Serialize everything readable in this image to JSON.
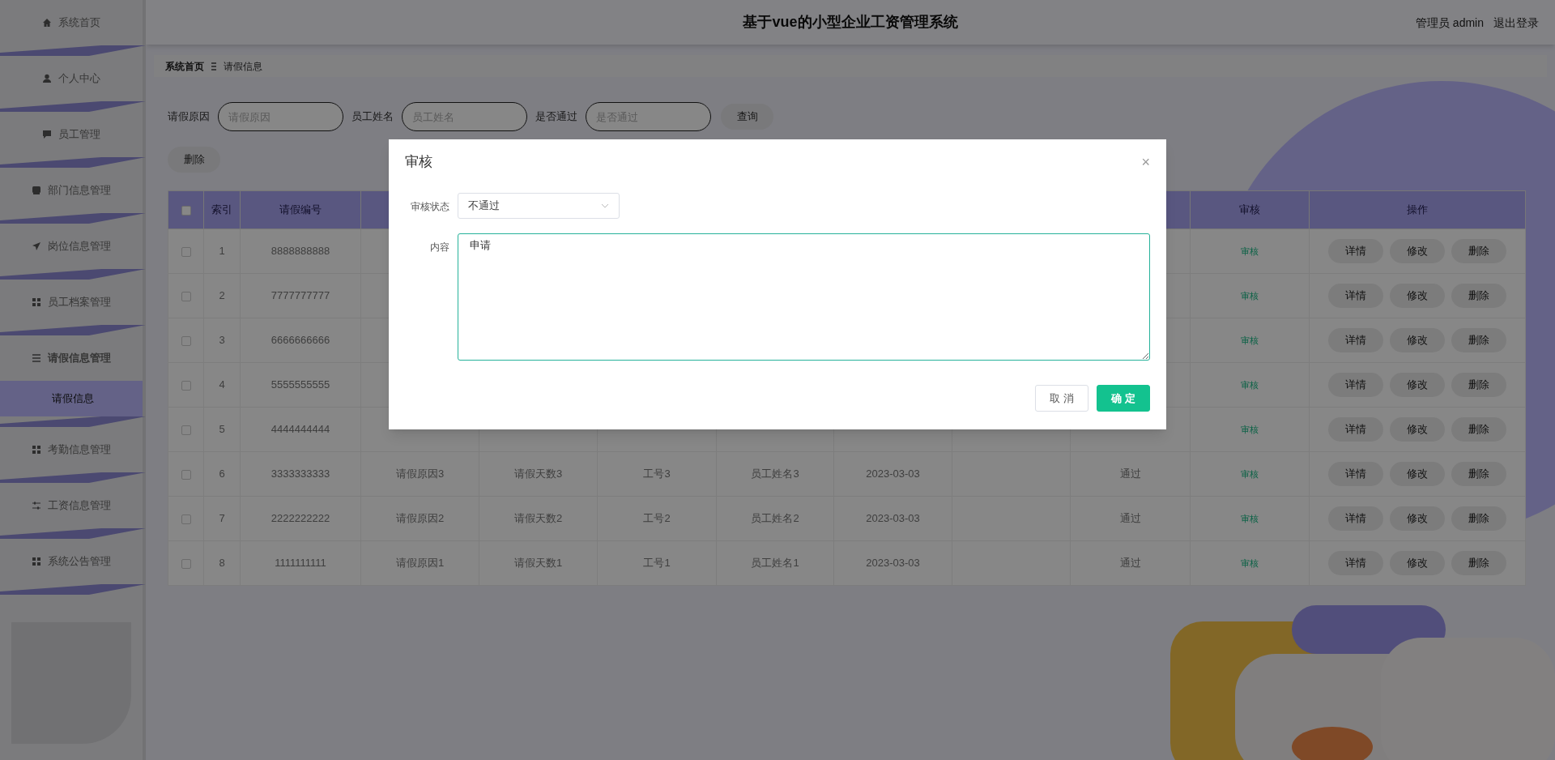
{
  "header": {
    "title": "基于vue的小型企业工资管理系统",
    "user": "管理员 admin",
    "logout": "退出登录"
  },
  "sidebar": {
    "items": [
      {
        "label": "系统首页",
        "selected": false
      },
      {
        "label": "个人中心",
        "selected": false
      },
      {
        "label": "员工管理",
        "selected": false
      },
      {
        "label": "部门信息管理",
        "selected": false
      },
      {
        "label": "岗位信息管理",
        "selected": false
      },
      {
        "label": "员工档案管理",
        "selected": false
      },
      {
        "label": "请假信息管理",
        "selected": false,
        "expanded": true,
        "children": [
          {
            "label": "请假信息",
            "selected": true
          }
        ]
      },
      {
        "label": "考勤信息管理",
        "selected": false
      },
      {
        "label": "工资信息管理",
        "selected": false
      },
      {
        "label": "系统公告管理",
        "selected": false
      }
    ]
  },
  "breadcrumb": [
    "系统首页",
    "请假信息"
  ],
  "filters": [
    {
      "label": "请假原因",
      "placeholder": "请假原因"
    },
    {
      "label": "员工姓名",
      "placeholder": "员工姓名"
    },
    {
      "label": "是否通过",
      "placeholder": "是否通过"
    }
  ],
  "search_button": "查询",
  "delete_button": "删除",
  "table": {
    "select_all": {
      "checked": false
    },
    "columns": [
      {
        "label": "索引"
      },
      {
        "label": "请假编号"
      },
      {},
      {},
      {},
      {},
      {},
      {},
      {},
      {
        "label": "审核"
      },
      {
        "label": "操作"
      }
    ],
    "rows": [
      {
        "checked": false,
        "cells": [
          "1",
          "8888888888",
          null,
          null,
          null,
          null,
          null,
          null,
          null
        ],
        "review": "审核",
        "actions": [
          "详情",
          "修改",
          "删除"
        ]
      },
      {
        "checked": false,
        "cells": [
          "2",
          "7777777777",
          null,
          null,
          null,
          null,
          null,
          null,
          null
        ],
        "review": "审核",
        "actions": [
          "详情",
          "修改",
          "删除"
        ]
      },
      {
        "checked": false,
        "cells": [
          "3",
          "6666666666",
          null,
          null,
          null,
          null,
          null,
          null,
          null
        ],
        "review": "审核",
        "actions": [
          "详情",
          "修改",
          "删除"
        ]
      },
      {
        "checked": false,
        "cells": [
          "4",
          "5555555555",
          null,
          null,
          null,
          null,
          null,
          null,
          null
        ],
        "review": "审核",
        "actions": [
          "详情",
          "修改",
          "删除"
        ]
      },
      {
        "checked": false,
        "cells": [
          "5",
          "4444444444",
          null,
          null,
          null,
          null,
          null,
          null,
          null
        ],
        "review": "审核",
        "actions": [
          "详情",
          "修改",
          "删除"
        ]
      },
      {
        "checked": false,
        "cells": [
          "6",
          "3333333333",
          "请假原因3",
          "请假天数3",
          "工号3",
          "员工姓名3",
          "2023-03-03",
          "",
          "通过"
        ],
        "review": "审核",
        "actions": [
          "详情",
          "修改",
          "删除"
        ]
      },
      {
        "checked": false,
        "cells": [
          "7",
          "2222222222",
          "请假原因2",
          "请假天数2",
          "工号2",
          "员工姓名2",
          "2023-03-03",
          "",
          "通过"
        ],
        "review": "审核",
        "actions": [
          "详情",
          "修改",
          "删除"
        ]
      },
      {
        "checked": false,
        "cells": [
          "8",
          "1111111111",
          "请假原因1",
          "请假天数1",
          "工号1",
          "员工姓名1",
          "2023-03-03",
          "",
          "通过"
        ],
        "review": "审核",
        "actions": [
          "详情",
          "修改",
          "删除"
        ]
      }
    ]
  },
  "dialog": {
    "title": "审核",
    "close": "×",
    "fields": [
      {
        "kind": "select",
        "label": "审核状态",
        "value": "不通过"
      },
      {
        "kind": "textarea",
        "label": "内容",
        "value": "申请"
      }
    ],
    "buttons": [
      {
        "kind": "cancel",
        "label": "取 消"
      },
      {
        "kind": "confirm",
        "label": "确 定"
      }
    ]
  }
}
